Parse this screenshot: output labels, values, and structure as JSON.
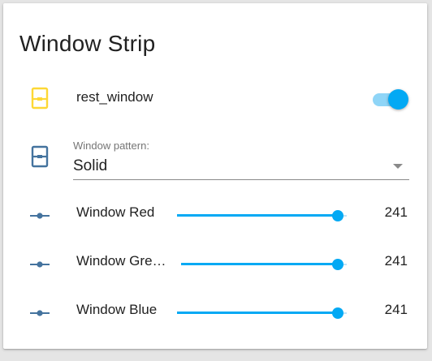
{
  "card": {
    "title": "Window Strip"
  },
  "switch_row": {
    "label": "rest_window",
    "state": "on",
    "icon": "window-shutter-open-icon"
  },
  "pattern": {
    "label": "Window pattern:",
    "value": "Solid",
    "icon": "window-shutter-icon"
  },
  "sliders": [
    {
      "label": "Window Red",
      "value": "241",
      "fraction": 0.945,
      "icon": "ray-vertex-icon"
    },
    {
      "label": "Window Gre…",
      "value": "241",
      "fraction": 0.945,
      "icon": "ray-vertex-icon"
    },
    {
      "label": "Window Blue",
      "value": "241",
      "fraction": 0.945,
      "icon": "ray-vertex-icon"
    }
  ],
  "colors": {
    "accent": "#03a9f4",
    "icon_on": "#fdd835",
    "icon_off": "#44739e"
  }
}
